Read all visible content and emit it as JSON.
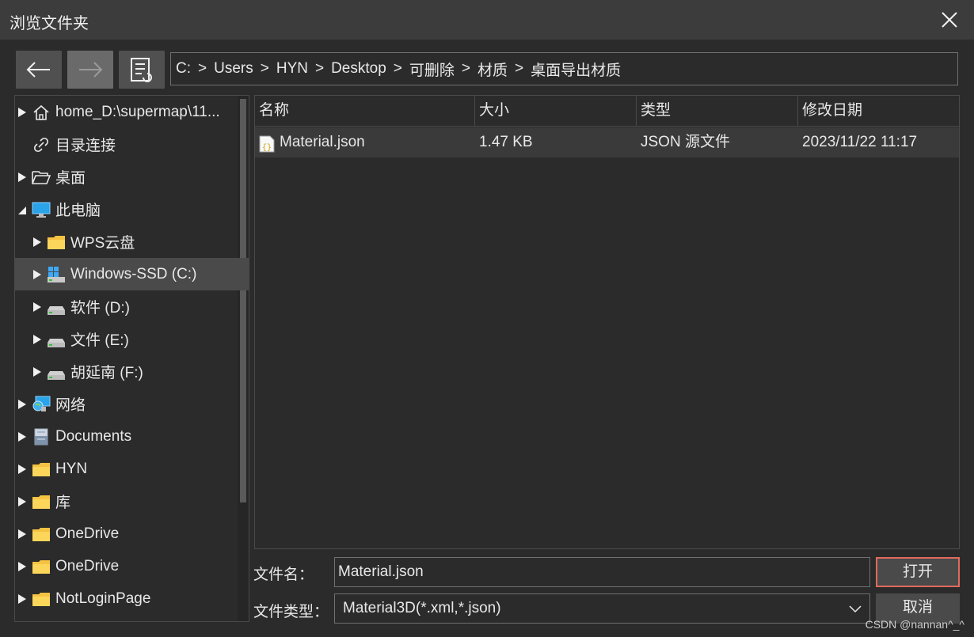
{
  "window": {
    "title": "浏览文件夹"
  },
  "path": [
    "C:",
    "Users",
    "HYN",
    "Desktop",
    "可删除",
    "材质",
    "桌面导出材质"
  ],
  "path_separator": ">",
  "tree": [
    {
      "label": "home_D:\\supermap\\11...",
      "icon": "home-icon",
      "expander": "collapsed",
      "indent": 0
    },
    {
      "label": "目录连接",
      "icon": "link-icon",
      "expander": "none",
      "indent": 0
    },
    {
      "label": "桌面",
      "icon": "folder-open-icon",
      "expander": "collapsed",
      "indent": 0
    },
    {
      "label": "此电脑",
      "icon": "computer-icon",
      "expander": "expanded",
      "indent": 0
    },
    {
      "label": "WPS云盘",
      "icon": "folder-icon",
      "expander": "collapsed",
      "indent": 1
    },
    {
      "label": "Windows-SSD (C:)",
      "icon": "windows-drive-icon",
      "expander": "collapsed",
      "indent": 1,
      "selected": true
    },
    {
      "label": "软件 (D:)",
      "icon": "drive-icon",
      "expander": "collapsed",
      "indent": 1
    },
    {
      "label": "文件 (E:)",
      "icon": "drive-icon",
      "expander": "collapsed",
      "indent": 1
    },
    {
      "label": "胡延南 (F:)",
      "icon": "drive-icon",
      "expander": "collapsed",
      "indent": 1
    },
    {
      "label": "网络",
      "icon": "network-icon",
      "expander": "collapsed",
      "indent": 0
    },
    {
      "label": "Documents",
      "icon": "documents-icon",
      "expander": "collapsed",
      "indent": 0
    },
    {
      "label": "HYN",
      "icon": "folder-icon",
      "expander": "collapsed",
      "indent": 0
    },
    {
      "label": "库",
      "icon": "folder-icon",
      "expander": "collapsed",
      "indent": 0
    },
    {
      "label": "OneDrive",
      "icon": "folder-icon",
      "expander": "collapsed",
      "indent": 0
    },
    {
      "label": "OneDrive",
      "icon": "folder-icon",
      "expander": "collapsed",
      "indent": 0
    },
    {
      "label": "NotLoginPage",
      "icon": "folder-icon",
      "expander": "collapsed",
      "indent": 0
    }
  ],
  "columns": {
    "name": "名称",
    "size": "大小",
    "type": "类型",
    "modified": "修改日期"
  },
  "files": [
    {
      "name": "Material.json",
      "size": "1.47 KB",
      "type": "JSON 源文件",
      "modified": "2023/11/22 11:17",
      "icon": "json-file-icon"
    }
  ],
  "filename": {
    "label": "文件名：",
    "value": "Material.json"
  },
  "filetype": {
    "label": "文件类型：",
    "value": "Material3D(*.xml,*.json)"
  },
  "buttons": {
    "open": "打开",
    "cancel": "取消"
  },
  "watermark": "CSDN @nannan^_^",
  "colors": {
    "accent_border": "#e06b5d",
    "folder": "#f5c342",
    "selection": "#4a4a4a"
  }
}
